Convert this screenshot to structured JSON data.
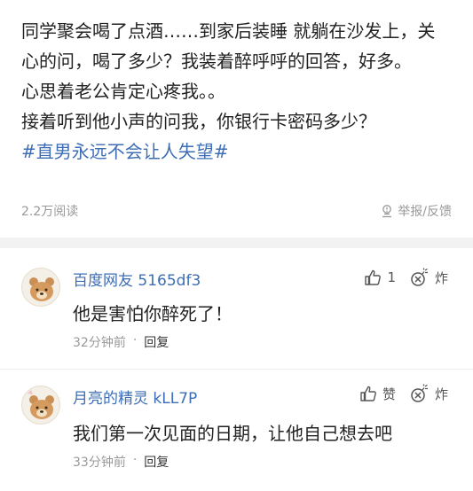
{
  "post": {
    "paragraphs": [
      "同学聚会喝了点酒……到家后装睡 就躺在沙发上，关心的问，喝了多少？我装着醉呼呼的回答，好多。",
      "心思着老公肯定心疼我。。",
      "接着听到他小声的问我，你银行卡密码多少？"
    ],
    "hashtag": "#直男永远不会让人失望#",
    "views": "2.2万阅读",
    "report_label": "举报/反馈"
  },
  "comments": [
    {
      "user": "百度网友 5165df3",
      "like_label": "1",
      "bomb_label": "炸",
      "text": "他是害怕你醉死了！",
      "time": "32分钟前",
      "dot": "·",
      "reply_label": "回复"
    },
    {
      "user": "月亮的精灵 kLL7P",
      "like_label": "赞",
      "bomb_label": "炸",
      "text": "我们第一次见面的日期，让他自己想去吧",
      "time": "33分钟前",
      "dot": "·",
      "reply_label": "回复"
    }
  ],
  "colors": {
    "link": "#3d6db5",
    "meta": "#999999",
    "background": "#f2f2f2"
  },
  "icons": [
    "thumbs-up-icon",
    "bomb-icon",
    "report-icon"
  ]
}
